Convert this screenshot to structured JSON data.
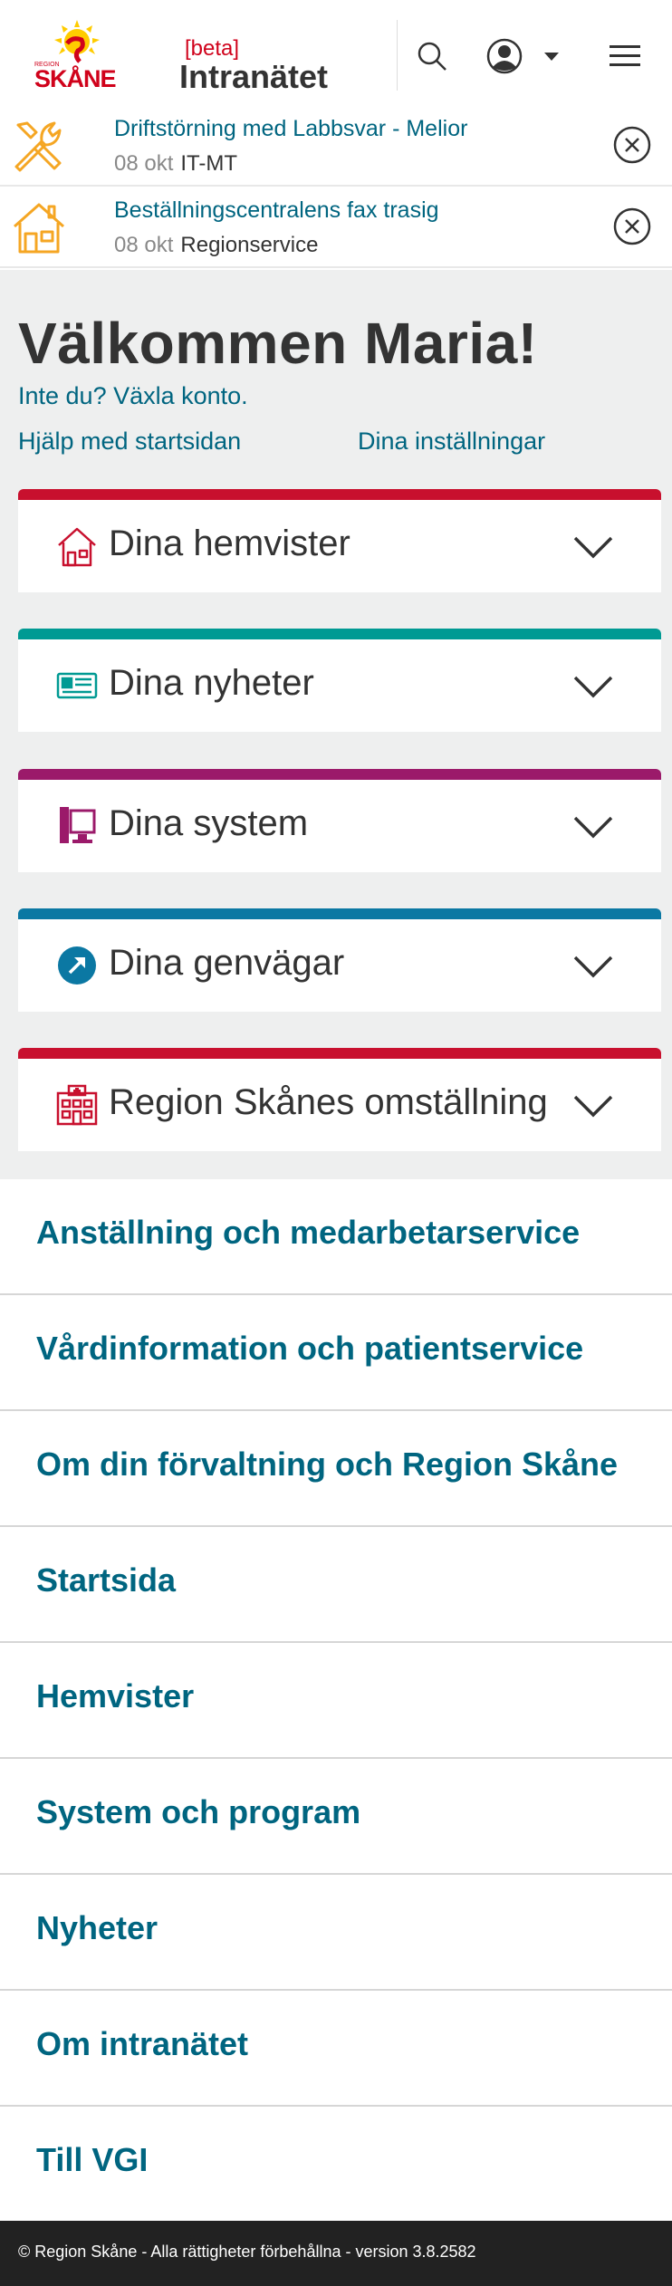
{
  "header": {
    "logo_text": "SKÅNE",
    "logo_small": "REGION",
    "beta": "[beta]",
    "title": "Intranätet"
  },
  "alerts": [
    {
      "title": "Driftstörning med Labbsvar - Melior",
      "date": "08 okt",
      "source": "IT-MT",
      "icon": "tools-icon"
    },
    {
      "title": "Beställningscentralens fax trasig",
      "date": "08 okt",
      "source": "Regionservice",
      "icon": "house-icon"
    }
  ],
  "main": {
    "welcome": "Välkommen Maria!",
    "switch_account": "Inte du? Växla konto.",
    "help_link": "Hjälp med startsidan",
    "settings_link": "Dina inställningar",
    "accordions": [
      {
        "label": "Dina hemvister",
        "color": "#c8102e",
        "icon": "home-icon"
      },
      {
        "label": "Dina nyheter",
        "color": "#009a93",
        "icon": "news-card-icon"
      },
      {
        "label": "Dina system",
        "color": "#9b1a6a",
        "icon": "computer-icon"
      },
      {
        "label": "Dina genvägar",
        "color": "#0b78a3",
        "icon": "shortcut-arrow-icon"
      },
      {
        "label": "Region Skånes omställning",
        "color": "#c8102e",
        "icon": "hospital-icon"
      }
    ]
  },
  "nav": {
    "items": [
      "Anställning och medarbetarservice",
      "Vårdinformation och patientservice",
      "Om din förvaltning och Region Skåne",
      "Startsida",
      "Hemvister",
      "System och program",
      "Nyheter",
      "Om intranätet",
      "Till VGI"
    ]
  },
  "footer": {
    "text": "© Region Skåne - Alla rättigheter förbehållna - version 3.8.2582"
  },
  "colors": {
    "accent": "#006580",
    "brand_red": "#d0021b",
    "alert_icon": "#f5a623"
  }
}
